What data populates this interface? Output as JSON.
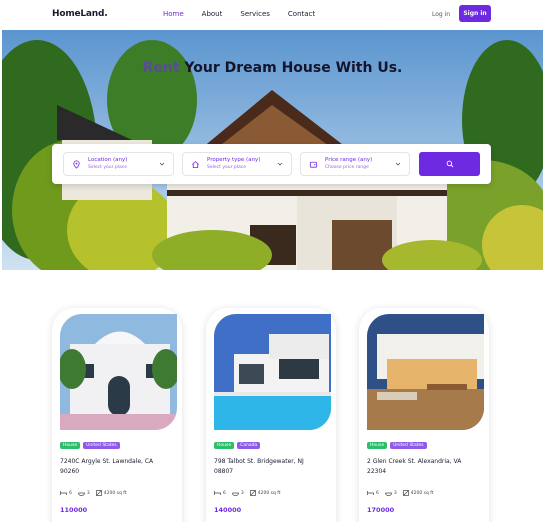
{
  "header": {
    "logo": "HomeLand",
    "nav": [
      {
        "label": "Home",
        "active": true
      },
      {
        "label": "About",
        "active": false
      },
      {
        "label": "Services",
        "active": false
      },
      {
        "label": "Contact",
        "active": false
      }
    ],
    "login_label": "Log in",
    "signin_label": "Sign in"
  },
  "hero": {
    "title_accent": "Rent",
    "title_rest": " Your Dream House With Us."
  },
  "search": {
    "location": {
      "label": "Location (any)",
      "placeholder": "Select your place",
      "icon": "map-pin-icon"
    },
    "property_type": {
      "label": "Property type (any)",
      "placeholder": "Select your place",
      "icon": "home-icon"
    },
    "price_range": {
      "label": "Price range (any)",
      "placeholder": "Choose price range",
      "icon": "wallet-icon"
    },
    "button_icon": "search-icon"
  },
  "listings": [
    {
      "tags": [
        "House",
        "United States"
      ],
      "address": "7240C Argyle St. Lawndale, CA 90260",
      "beds": "6",
      "baths": "3",
      "area": "4200 sq ft",
      "price": "110000"
    },
    {
      "tags": [
        "House",
        "Canada"
      ],
      "address": "798 Talbot St. Bridgewater, NJ 08807",
      "beds": "6",
      "baths": "3",
      "area": "4200 sq ft",
      "price": "140000"
    },
    {
      "tags": [
        "House",
        "United States"
      ],
      "address": "2 Glen Creek St. Alexandria, VA 22304",
      "beds": "6",
      "baths": "3",
      "area": "4200 sq ft",
      "price": "170000"
    }
  ],
  "colors": {
    "accent": "#6d2ae0",
    "tag_green": "#2ebd6b",
    "tag_purple": "#8f5ae8"
  }
}
